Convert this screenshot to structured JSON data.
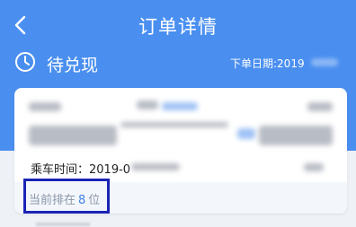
{
  "header": {
    "title": "订单详情"
  },
  "status": {
    "text": "待兑现",
    "order_date": "下单日期:2019"
  },
  "ticket": {
    "ride_time": "乘车时间：2019-0"
  },
  "rank": {
    "prefix": "当前排在",
    "position": "8",
    "suffix": "位"
  }
}
